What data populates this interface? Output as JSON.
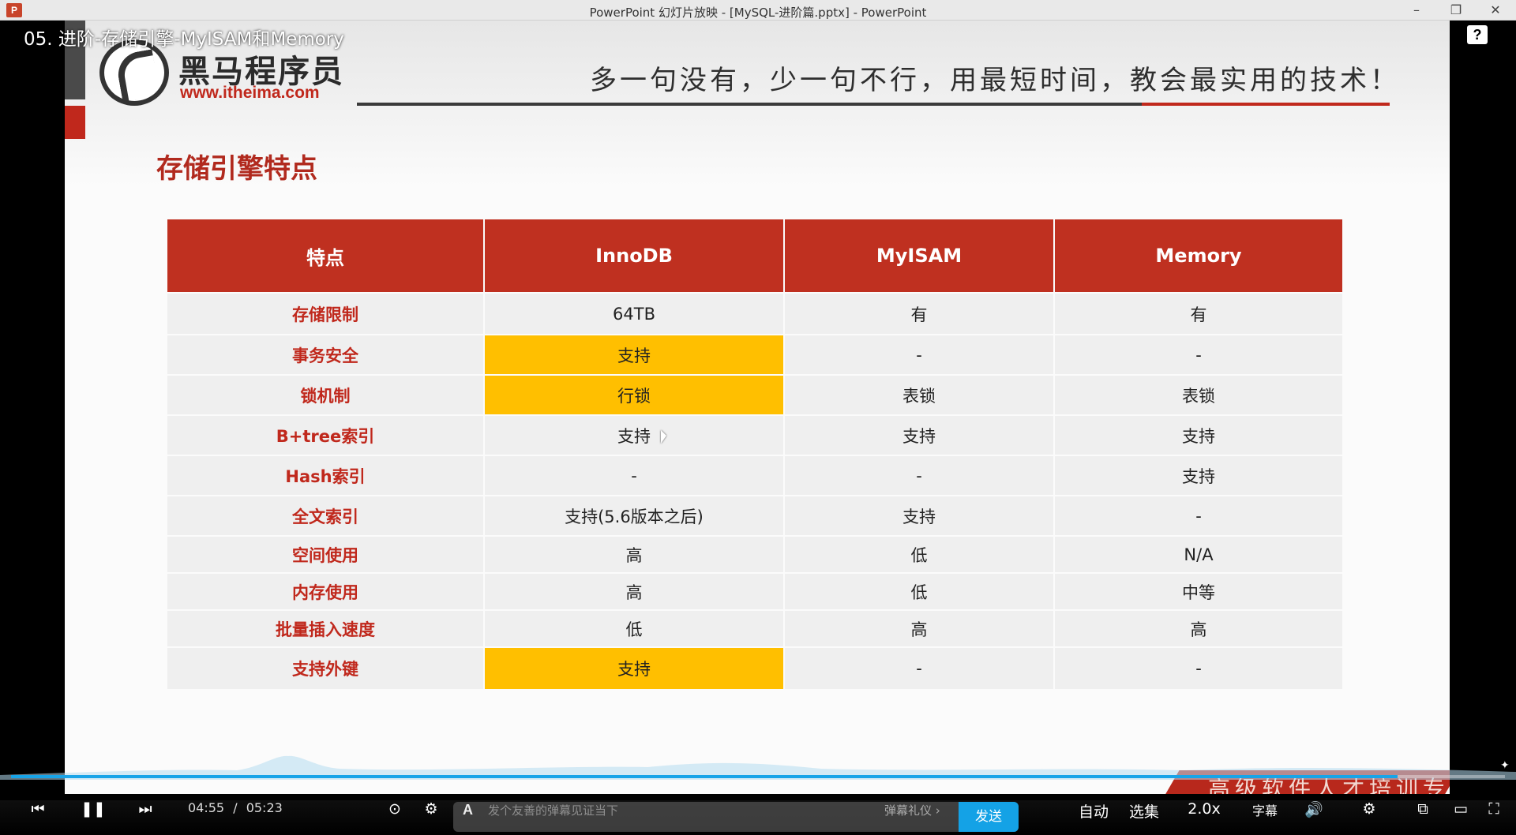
{
  "window": {
    "logo_letter": "P",
    "title": "PowerPoint 幻灯片放映 - [MySQL-进阶篇.pptx] - PowerPoint",
    "minimize": "–",
    "restore": "❐",
    "close": "✕"
  },
  "video": {
    "title": "05. 进阶-存储引擎-MyISAM和Memory",
    "help": "?",
    "progress_fraction": 0.928
  },
  "slide": {
    "logo_cn": "黑马程序员",
    "logo_url": "www.itheima.com",
    "slogan": "多一句没有，少一句不行，用最短时间，教会最实用的技术！",
    "heading": "存储引擎特点",
    "banner": "高级软件人才培训专家"
  },
  "table": {
    "headers": [
      "特点",
      "InnoDB",
      "MyISAM",
      "Memory"
    ],
    "rows": [
      [
        "存储限制",
        "64TB",
        "有",
        "有"
      ],
      [
        "事务安全",
        "支持",
        "-",
        "-"
      ],
      [
        "锁机制",
        "行锁",
        "表锁",
        "表锁"
      ],
      [
        "B+tree索引",
        "支持",
        "支持",
        "支持"
      ],
      [
        "Hash索引",
        "-",
        "-",
        "支持"
      ],
      [
        "全文索引",
        "支持(5.6版本之后)",
        "支持",
        "-"
      ],
      [
        "空间使用",
        "高",
        "低",
        "N/A"
      ],
      [
        "内存使用",
        "高",
        "低",
        "中等"
      ],
      [
        "批量插入速度",
        "低",
        "高",
        "高"
      ],
      [
        "支持外键",
        "支持",
        "-",
        "-"
      ]
    ]
  },
  "player": {
    "prev_icon": "⏮",
    "pause_icon": "❚❚",
    "next_icon": "⏭",
    "current_time": "04:55",
    "separator": "/",
    "duration": "05:23",
    "danmaku_toggle_icon": "⊙",
    "danmaku_settings_icon": "⚙",
    "danmaku_a": "A",
    "danmaku_placeholder": "发个友善的弹幕见证当下",
    "danmaku_etiquette": "弹幕礼仪 ›",
    "send": "发送",
    "auto": "自动",
    "episodes": "选集",
    "speed": "2.0x",
    "subtitle": "字幕",
    "volume_icon": "🔊",
    "settings_icon": "⚙",
    "pip_icon": "⧉",
    "widescreen_icon": "▭",
    "fullscreen_icon": "⛶"
  }
}
